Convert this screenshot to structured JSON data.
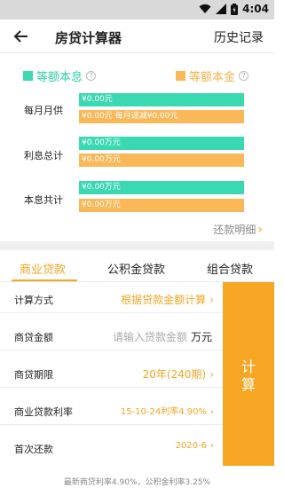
{
  "status_bar": {
    "time": "4:04",
    "icons": [
      "wifi-icon",
      "signal-icon",
      "battery-icon"
    ]
  },
  "header": {
    "title": "房贷计算器",
    "history_label": "历史记录"
  },
  "legend": {
    "interest": {
      "label": "等额本息",
      "color": "#2ed0a6"
    },
    "principal": {
      "label": "等额本金",
      "color": "#f5b24a"
    }
  },
  "summary": {
    "monthly": {
      "label": "每月月供",
      "interest_value": "¥0.00元",
      "principal_value": "¥0.00元  每月递减¥0.00元"
    },
    "total_interest": {
      "label": "利息总计",
      "interest_value": "¥0.00万元",
      "principal_value": "¥0.00万元"
    },
    "total": {
      "label": "本息共计",
      "interest_value": "¥0.00万元",
      "principal_value": "¥0.00万元"
    }
  },
  "detail_link": "还款明细",
  "tabs": [
    {
      "label": "商业贷款",
      "active": true
    },
    {
      "label": "公积金贷款",
      "active": false
    },
    {
      "label": "组合贷款",
      "active": false
    }
  ],
  "form": {
    "method": {
      "label": "计算方式",
      "value": "根据贷款金额计算"
    },
    "amount": {
      "label": "商贷金额",
      "placeholder": "请输入贷款金额",
      "unit": "万元"
    },
    "term": {
      "label": "商贷期限",
      "value": "20年(240期)"
    },
    "rate": {
      "label": "商业贷款利率",
      "value": "15-10-24利率4.90%"
    },
    "first_payment": {
      "label": "首次还款",
      "value": "2020-6"
    }
  },
  "calculate_button": [
    "计",
    "算"
  ],
  "footer_note": "最新商贷利率4.90%，公积金利率3.25%",
  "colors": {
    "accent": "#f5a623",
    "green": "#3ad9b1",
    "orange": "#fbb859"
  }
}
